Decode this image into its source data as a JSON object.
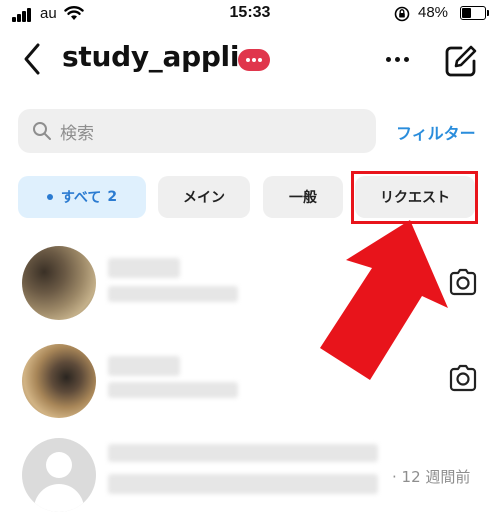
{
  "status_bar": {
    "carrier": "au",
    "time": "15:33",
    "battery": "48%",
    "battery_level": 0.48,
    "icons": [
      "signal-icon",
      "wifi-icon",
      "rotation-lock-icon",
      "battery-icon"
    ]
  },
  "header": {
    "title": "study_appli",
    "icons": [
      "back-chevron-icon",
      "more-dots-badge-icon",
      "more-options-icon",
      "compose-icon"
    ]
  },
  "search": {
    "placeholder": "検索",
    "filter_label": "フィルター",
    "icon": "search-icon"
  },
  "tabs": [
    {
      "label": "すべて",
      "count": "2",
      "active": true
    },
    {
      "label": "メイン",
      "active": false
    },
    {
      "label": "一般",
      "active": false
    },
    {
      "label": "リクエスト",
      "active": false,
      "highlighted": true
    }
  ],
  "annotation": {
    "highlight_color": "#e8141b",
    "arrow_color": "#e8141b"
  },
  "threads": [
    {
      "avatar": "cat-photo-avatar",
      "action_icon": "camera-icon"
    },
    {
      "avatar": "cat-photo-avatar",
      "action_icon": "camera-icon"
    },
    {
      "avatar": "default-avatar",
      "time_ago": "· 12 週間前"
    }
  ],
  "colors": {
    "accent": "#2a8ddc",
    "badge": "#e0364c",
    "chip_bg": "#efefef",
    "chip_active_bg": "#dff0fd"
  }
}
